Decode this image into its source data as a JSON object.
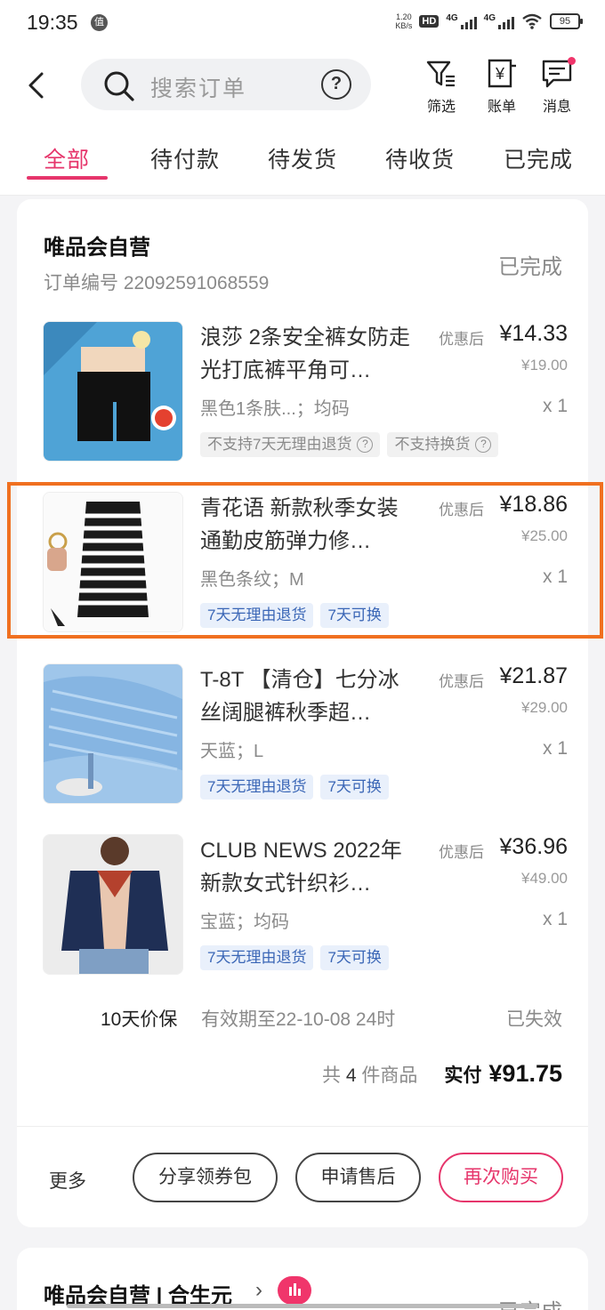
{
  "status_bar": {
    "time": "19:35",
    "notif_badge": "值",
    "net_speed_value": "1.20",
    "net_speed_unit": "KB/s",
    "hd_label": "HD",
    "sim1": "4G",
    "sim2": "4G",
    "battery": "95"
  },
  "header": {
    "search_placeholder": "搜索订单",
    "help_label": "?",
    "filter_label": "筛选",
    "bill_label": "账单",
    "message_label": "消息",
    "bill_glyph": "¥"
  },
  "tabs": {
    "all": "全部",
    "pending_pay": "待付款",
    "pending_ship": "待发货",
    "pending_receive": "待收货",
    "completed": "已完成",
    "active_index": 0
  },
  "order": {
    "shop": "唯品会自营",
    "order_no": "订单编号 22092591068559",
    "status": "已完成",
    "items": [
      {
        "title": "浪莎 2条安全裤女防走光打底裤平角可…",
        "spec": "黑色1条肤...；均码",
        "price_prefix": "优惠后",
        "price": "¥14.33",
        "orig_price": "¥19.00",
        "qty": "x 1",
        "tags": [
          "不支持7天无理由退货",
          "不支持换货"
        ]
      },
      {
        "title": "青花语 新款秋季女装通勤皮筋弹力修…",
        "spec": "黑色条纹；M",
        "price_prefix": "优惠后",
        "price": "¥18.86",
        "orig_price": "¥25.00",
        "qty": "x 1",
        "tags": [
          "7天无理由退货",
          "7天可换"
        ]
      },
      {
        "title": "T-8T 【清仓】七分冰丝阔腿裤秋季超…",
        "spec": "天蓝；L",
        "price_prefix": "优惠后",
        "price": "¥21.87",
        "orig_price": "¥29.00",
        "qty": "x 1",
        "tags": [
          "7天无理由退货",
          "7天可换"
        ]
      },
      {
        "title": "CLUB NEWS 2022年新款女式针织衫…",
        "spec": "宝蓝；均码",
        "price_prefix": "优惠后",
        "price": "¥36.96",
        "orig_price": "¥49.00",
        "qty": "x 1",
        "tags": [
          "7天无理由退货",
          "7天可换"
        ]
      }
    ],
    "price_protect": {
      "title": "10天价保",
      "validity": "有效期至22-10-08 24时",
      "status": "已失效"
    },
    "total": {
      "count_prefix": "共",
      "count": "4",
      "count_suffix": "件商品",
      "paid_label": "实付",
      "amount": "¥91.75"
    },
    "actions": {
      "more": "更多",
      "share": "分享领券包",
      "after_sale": "申请售后",
      "rebuy": "再次购买"
    }
  },
  "next_order": {
    "shop": "唯品会自营 | 合生元",
    "chevron": "›",
    "status": "已完成"
  },
  "colors": {
    "accent": "#e6356b",
    "highlight_box": "#f07020",
    "tag_blue_bg": "#e9f0fb",
    "tag_blue_text": "#3a66b6"
  }
}
